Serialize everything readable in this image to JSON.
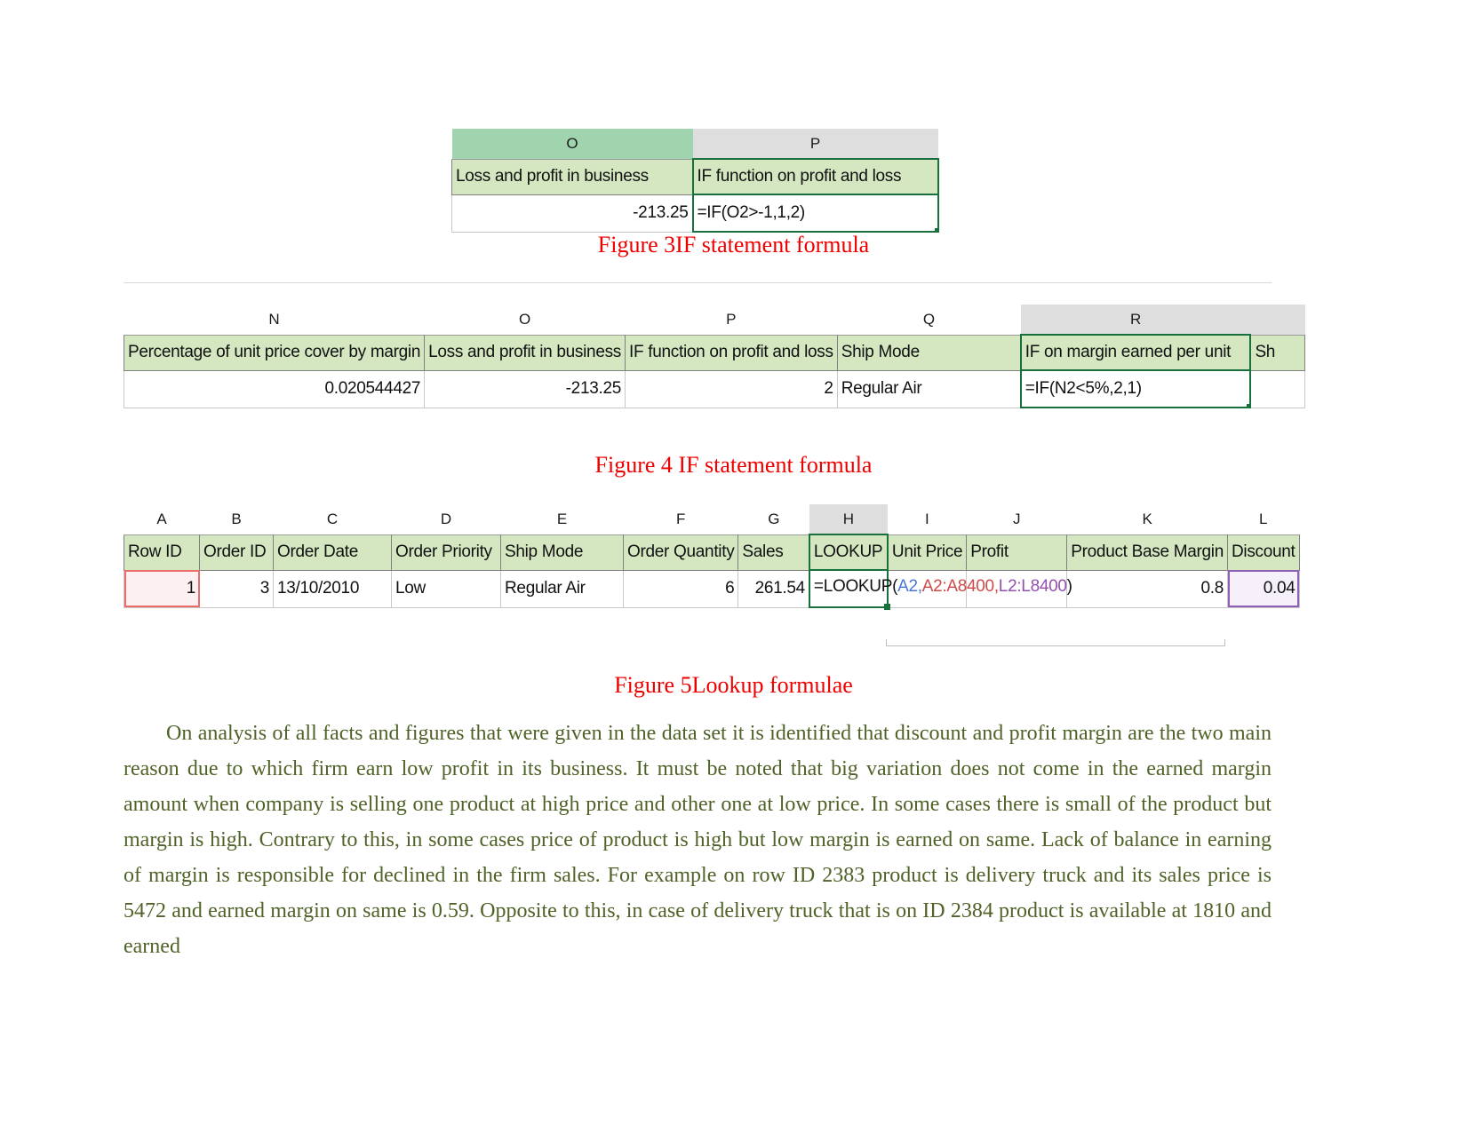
{
  "figure3": {
    "column_letters": [
      "O",
      "P"
    ],
    "headers": [
      "Loss and profit in business",
      "IF function on profit and loss"
    ],
    "data_row": [
      "-213.25",
      "=IF(O2>-1,1,2)"
    ],
    "active_column": "P",
    "caption": "Figure 3IF statement formula"
  },
  "figure4": {
    "column_letters": [
      "N",
      "O",
      "P",
      "Q",
      "R",
      ""
    ],
    "headers": [
      "Percentage of unit price cover by margin",
      "Loss and profit in business",
      "IF function on profit and loss",
      "Ship Mode",
      "IF on margin earned per unit",
      "Sh"
    ],
    "data_row": [
      "0.020544427",
      "-213.25",
      "2",
      "Regular Air",
      "=IF(N2<5%,2,1)",
      ""
    ],
    "active_column": "R",
    "caption": "Figure 4 IF statement formula"
  },
  "figure5": {
    "column_letters": [
      "A",
      "B",
      "C",
      "D",
      "E",
      "F",
      "G",
      "H",
      "I",
      "J",
      "K",
      "L"
    ],
    "headers": [
      "Row ID",
      "Order ID",
      "Order Date",
      "Order Priority",
      "Ship Mode",
      "Order Quantity",
      "Sales",
      "LOOKUP",
      "Unit Price",
      "Profit",
      "Product Base Margin",
      "Discount"
    ],
    "data_row": [
      "1",
      "3",
      "13/10/2010",
      "Low",
      "Regular Air",
      "6",
      "261.54",
      "",
      "",
      "",
      "0.8",
      "0.04"
    ],
    "active_column": "H",
    "formula": {
      "prefix": "=LOOKUP(",
      "arg1": "A2",
      "sep1": ",",
      "arg2": "A2:A8400",
      "sep2": ",",
      "arg3": "L2:L8400",
      "suffix": ")"
    },
    "caption": "Figure 5Lookup formulae"
  },
  "body": {
    "paragraph": "On analysis of all facts and figures that were given in the data set it is identified that discount and profit margin are the two main reason due to which firm earn low profit in its business. It must be noted that big variation does not come in the earned margin amount when company is selling one product at high price and other one at low price. In some cases there is small of the product but margin is high. Contrary to this, in some cases price of product is high but low margin is earned on same. Lack of balance in earning of margin is responsible for declined in the firm sales. For example on row ID 2383 product is delivery truck and its sales price is 5472 and earned margin on same is 0.59. Opposite to this, in case of delivery truck that is on ID 2384 product is available at 1810 and earned"
  },
  "colors": {
    "caption_red": "#ee0000",
    "body_green": "#4f6228",
    "header_fill": "#d4e7c0",
    "colhdr_grey": "#dedede",
    "colhdr_green": "#9fd4ae",
    "selection_green": "#18703c",
    "ref_blue": "#4a77d4",
    "ref_red": "#d04a4a",
    "ref_purple": "#9350b0"
  }
}
